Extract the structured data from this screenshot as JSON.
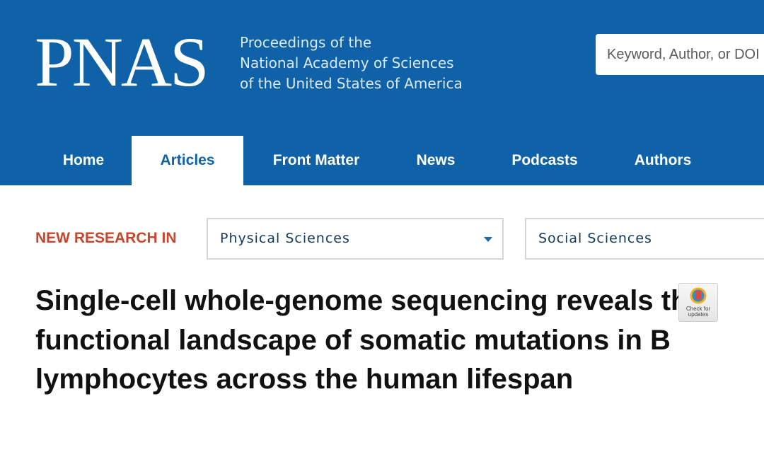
{
  "header": {
    "logo_text": "PNAS",
    "tagline_lines": [
      "Proceedings of the",
      "National Academy of Sciences",
      "of the United States of America"
    ],
    "search_placeholder": "Keyword, Author, or DOI"
  },
  "nav": {
    "tabs": [
      {
        "label": "Home",
        "active": false
      },
      {
        "label": "Articles",
        "active": true
      },
      {
        "label": "Front Matter",
        "active": false
      },
      {
        "label": "News",
        "active": false
      },
      {
        "label": "Podcasts",
        "active": false
      },
      {
        "label": "Authors",
        "active": false
      }
    ]
  },
  "research": {
    "label": "NEW RESEARCH IN",
    "selects": [
      {
        "value": "Physical Sciences"
      },
      {
        "value": "Social Sciences"
      }
    ]
  },
  "article": {
    "title": "Single-cell whole-genome sequencing reveals the functional landscape of somatic mutations in B lymphocytes across the human lifespan",
    "badge_lines": [
      "Check for",
      "updates"
    ]
  },
  "colors": {
    "brand_blue": "#0f62a8",
    "label_red": "#c8452c"
  }
}
